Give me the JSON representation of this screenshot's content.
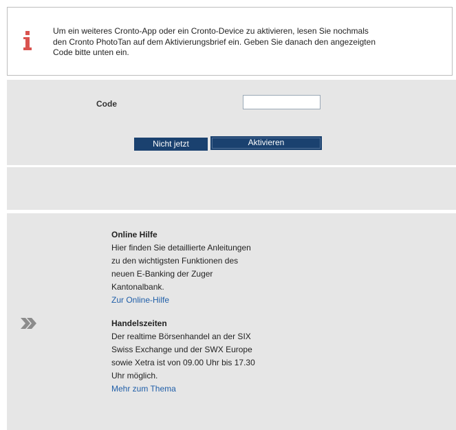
{
  "notice": {
    "text_line1": "Um ein weiteres Cronto-App oder ein Cronto-Device zu aktivieren, lesen Sie nochmals",
    "text_line2": "den Cronto PhotoTan auf dem Aktivierungsbrief ein. Geben Sie danach den angezeigten",
    "text_line3": "Code bitte unten ein.",
    "icon": "info-icon",
    "icon_color": "#d9534f"
  },
  "form": {
    "code_label": "Code",
    "code_value": "",
    "not_now_label": "Nicht jetzt",
    "activate_label": "Aktivieren",
    "button_color": "#1a416f"
  },
  "sidebar_info": {
    "arrow_icon": "chevron-right-double-icon",
    "help": {
      "title": "Online Hilfe",
      "line1": "Hier finden Sie detaillierte Anleitungen",
      "line2": "zu den wichtigsten Funktionen des",
      "line3": "neuen E-Banking der Zuger",
      "line4": "Kantonalbank.",
      "link": "Zur Online-Hilfe"
    },
    "hours": {
      "title": "Handelszeiten",
      "line1": "Der realtime Börsenhandel an der SIX",
      "line2": "Swiss Exchange und der SWX Europe",
      "line3": "sowie Xetra ist von 09.00 Uhr bis 17.30",
      "line4": "Uhr möglich.",
      "link": "Mehr zum Thema"
    },
    "link_color": "#1f5ea8"
  }
}
